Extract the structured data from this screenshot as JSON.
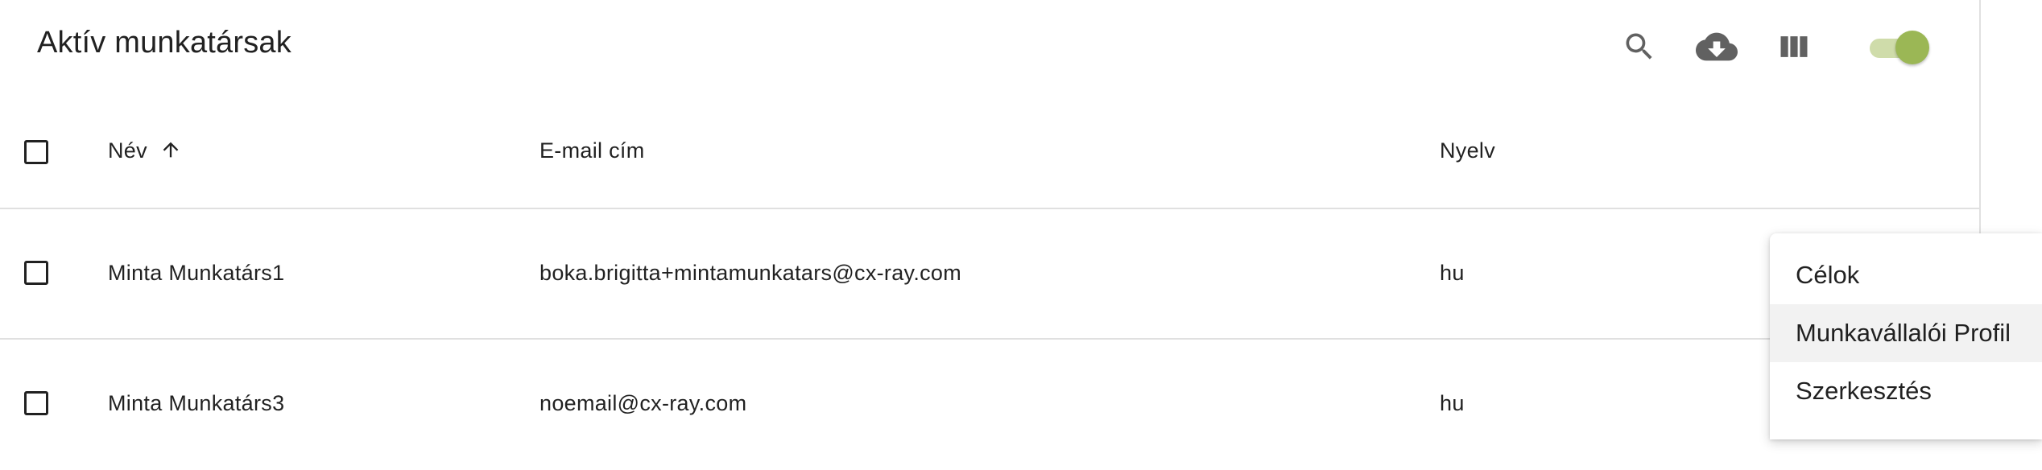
{
  "toolbar": {
    "title": "Aktív munkatársak",
    "icons": [
      "search-icon",
      "cloud-download-icon",
      "view-column-icon",
      "toggle-switch"
    ],
    "toggle_on": true,
    "accent_color": "#9bb755"
  },
  "table": {
    "columns": {
      "name": "Név",
      "email": "E-mail cím",
      "language": "Nyelv"
    },
    "sort": {
      "column": "Név",
      "direction": "ascending",
      "icon": "arrow-up-icon"
    },
    "rows": [
      {
        "name": "Minta Munkatárs1",
        "email": "boka.brigitta+mintamunkatars@cx-ray.com",
        "language": "hu"
      },
      {
        "name": "Minta Munkatárs3",
        "email": "noemail@cx-ray.com",
        "language": "hu"
      }
    ]
  },
  "context_menu": {
    "items": [
      {
        "label": "Célok"
      },
      {
        "label": "Munkavállalói Profil",
        "highlighted": true
      },
      {
        "label": "Szerkesztés"
      }
    ]
  }
}
